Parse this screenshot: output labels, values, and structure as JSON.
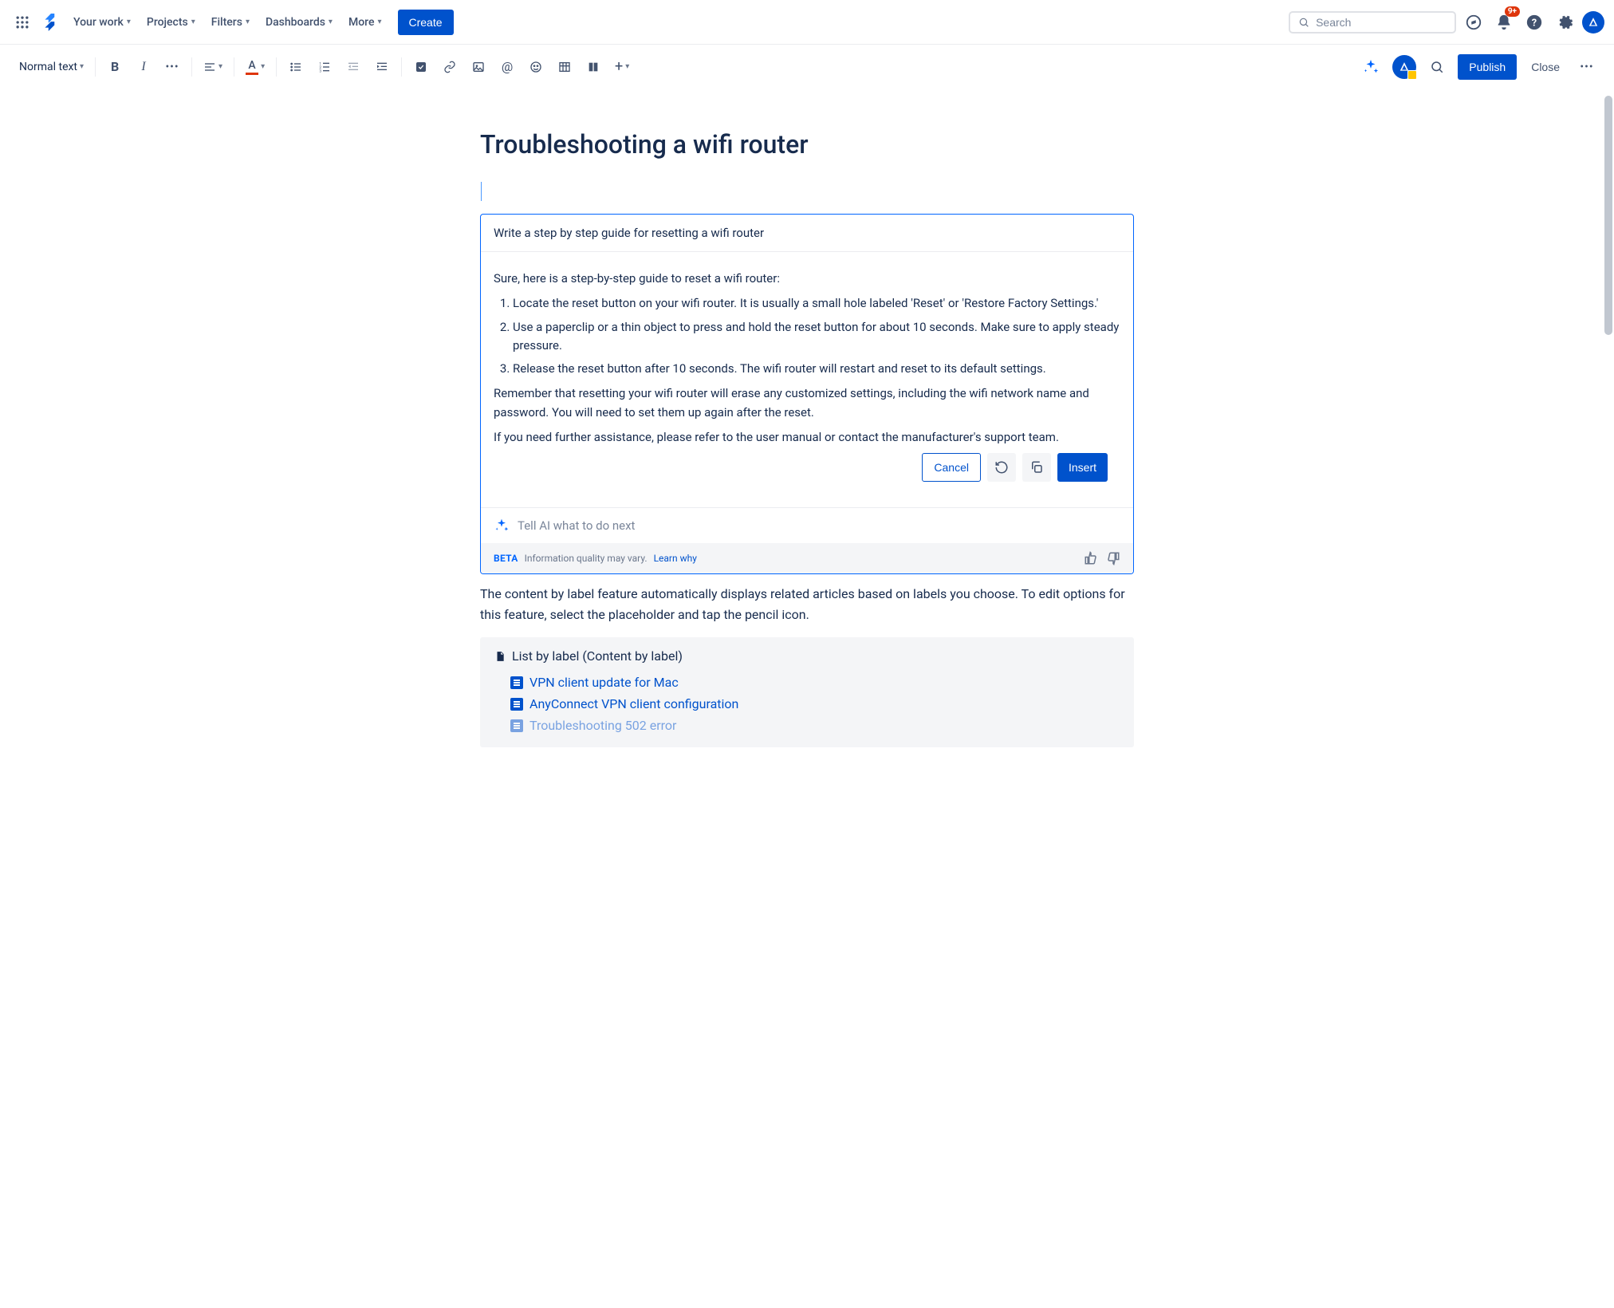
{
  "topbar": {
    "nav": [
      "Your work",
      "Projects",
      "Filters",
      "Dashboards",
      "More"
    ],
    "create": "Create",
    "search_placeholder": "Search",
    "notification_badge": "9+"
  },
  "toolbar": {
    "text_style": "Normal text",
    "publish": "Publish",
    "close": "Close"
  },
  "page": {
    "title": "Troubleshooting a wifi router"
  },
  "ai": {
    "prompt": "Write a step by step guide for resetting a wifi router",
    "intro": "Sure, here is a step-by-step guide to reset a wifi router:",
    "steps": [
      "Locate the reset button on your wifi router. It is usually a small hole labeled 'Reset' or 'Restore Factory Settings.'",
      "Use a paperclip or a thin object to press and hold the reset button for about 10 seconds. Make sure to apply steady pressure.",
      "Release the reset button after 10 seconds. The wifi router will restart and reset to its default settings."
    ],
    "note1": "Remember that resetting your wifi router will erase any customized settings, including the wifi network name and password. You will need to set them up again after the reset.",
    "note2": "If you need further assistance, please refer to the user manual or contact the manufacturer's support team.",
    "cancel": "Cancel",
    "insert": "Insert",
    "next_placeholder": "Tell AI what to do next",
    "beta": "BETA",
    "disclaimer": "Information quality may vary.",
    "learn": "Learn why"
  },
  "content": {
    "para": "The content by label feature automatically displays related articles based on labels you choose. To edit options for this feature, select the placeholder and tap the pencil icon.",
    "label_head": "List by label (Content by label)",
    "links": [
      "VPN client update for Mac",
      "AnyConnect VPN client configuration",
      "Troubleshooting 502 error"
    ]
  }
}
